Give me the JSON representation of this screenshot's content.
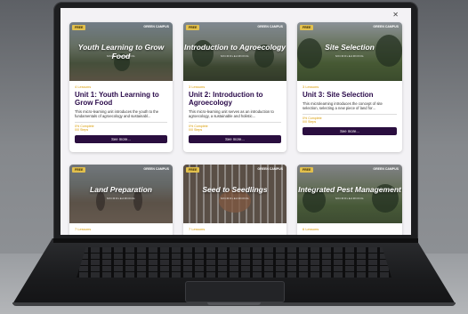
{
  "header": {
    "close_label": "✕"
  },
  "courses": [
    {
      "badge": "FREE",
      "logo": "GREEN CAMPUS",
      "banner_title": "Youth Learning to Grow Food",
      "banner_sub": "MICROLEARNING",
      "lessons": "4 Lessons",
      "title": "Unit 1: Youth Learning to Grow Food",
      "description": "This micro-learning unit introduces the youth to the fundamentals of agroecology and sustainabl...",
      "complete": "0% Complete",
      "steps": "0/0 Steps",
      "button": "See more..."
    },
    {
      "badge": "FREE",
      "logo": "GREEN CAMPUS",
      "banner_title": "Introduction to Agroecology",
      "banner_sub": "MICROLEARNING",
      "lessons": "3 Lessons",
      "title": "Unit 2: Introduction to Agroecology",
      "description": "This micro-learning unit serves as an introduction to agroecology, a sustainable and holistic...",
      "complete": "0% Complete",
      "steps": "0/0 Steps",
      "button": "See more..."
    },
    {
      "badge": "FREE",
      "logo": "GREEN CAMPUS",
      "banner_title": "Site Selection",
      "banner_sub": "MICROLEARNING",
      "lessons": "3 Lessons",
      "title": "Unit 3: Site Selection",
      "description": "This microlearning introduces the concept of site selection, selecting a new piece of land for...",
      "complete": "0% Complete",
      "steps": "0/0 Steps",
      "button": "See more..."
    },
    {
      "badge": "FREE",
      "logo": "GREEN CAMPUS",
      "banner_title": "Land Preparation",
      "banner_sub": "MICROLEARNING",
      "lessons": "7 Lessons"
    },
    {
      "badge": "FREE",
      "logo": "GREEN CAMPUS",
      "banner_title": "Seed to Seedlings",
      "banner_sub": "MICROLEARNING",
      "lessons": "7 Lessons"
    },
    {
      "badge": "FREE",
      "logo": "GREEN CAMPUS",
      "banner_title": "Integrated Pest Management",
      "banner_sub": "MICROLEARNING",
      "lessons": "6 Lessons"
    }
  ],
  "colors": {
    "accent_orange": "#d99b00",
    "title_purple": "#2a0a4a",
    "button_purple": "#2a0e3f",
    "badge_yellow": "#e2c04d"
  }
}
